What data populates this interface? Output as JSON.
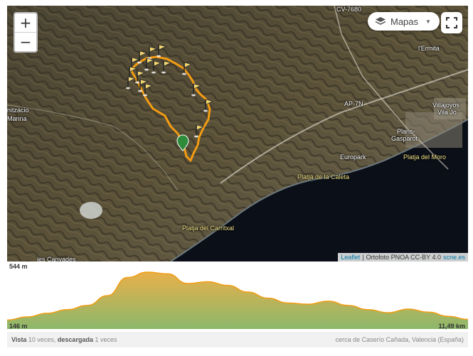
{
  "map": {
    "zoom_in_label": "+",
    "zoom_out_label": "−",
    "layer_button_label": "Mapas",
    "attribution": {
      "leaflet": "Leaflet",
      "separator": "|",
      "ortofoto": "Ortofoto PNOA CC-BY 4.0",
      "scne": "scne.es"
    },
    "labels": {
      "cv7680": "CV-7680",
      "ermita": "l'Ermita",
      "ap7n": "AP-7N",
      "villajoyosa": "Villajoyos",
      "vila_jo": "Vila Jo",
      "plans": "Plans-",
      "gasparot": "Gasparot",
      "europark": "Europark",
      "platja_moro": "Platja del Moro",
      "platja_caleta": "Platja de la Caleta",
      "platja_carritxal": "Platja del Carritxal",
      "les_canyades": "les Canyades",
      "nitzacio": "nitzacio",
      "marina": "Marina"
    },
    "icons": {
      "waypoint": "flag-icon",
      "start": "map-pin-icon",
      "layers": "layers-icon",
      "fullscreen": "fullscreen-icon"
    },
    "colors": {
      "track": "#f39c12",
      "pin": "#2e8b3a",
      "sea": "#0b0f18"
    }
  },
  "elevation": {
    "max_label": "544 m",
    "min_label": "146 m",
    "distance_label": "11,49 km",
    "max_m": 544,
    "min_m": 146,
    "total_km": 11.49,
    "profile_km": [
      0,
      0.5,
      1,
      1.5,
      2,
      2.5,
      3,
      3.5,
      4,
      4.5,
      5,
      5.5,
      6,
      6.5,
      7,
      7.5,
      8,
      8.5,
      9,
      9.5,
      10,
      10.5,
      11,
      11.49
    ],
    "profile_m": [
      150,
      175,
      205,
      235,
      270,
      350,
      500,
      544,
      530,
      450,
      465,
      435,
      380,
      330,
      290,
      280,
      305,
      270,
      235,
      210,
      240,
      215,
      180,
      155
    ],
    "colors": {
      "top": "#e8b04a",
      "bottom": "#8cb86b",
      "line": "#f39c12"
    }
  },
  "footer": {
    "views_prefix": "Vista",
    "views_count": "10 veces,",
    "downloads_label": "descargada",
    "downloads_count": "1 veces",
    "location": "cerca de Caserío Cañada, Valencia (España)"
  }
}
